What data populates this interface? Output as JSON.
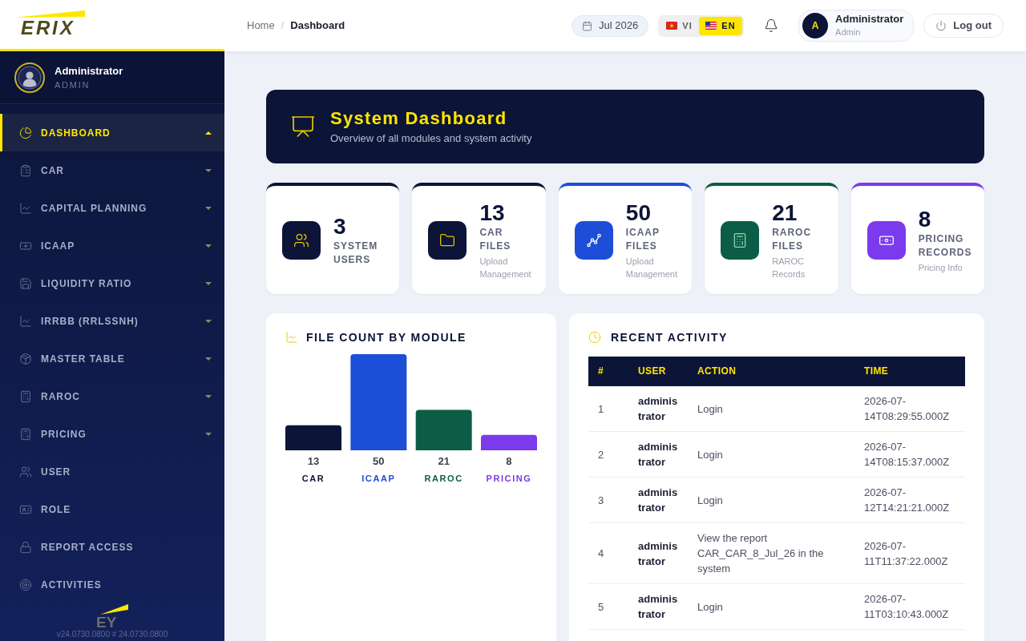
{
  "header": {
    "logo": "ERIX",
    "breadcrumb": [
      {
        "label": "Home",
        "current": false
      },
      {
        "label": "Dashboard",
        "current": true
      }
    ],
    "breadcrumb_separator": "/",
    "date": "Jul 2026",
    "languages": [
      {
        "code": "VI",
        "selected": false
      },
      {
        "code": "EN",
        "selected": true
      }
    ],
    "user": {
      "avatar_letter": "A",
      "name": "Administrator",
      "role": "Admin"
    },
    "logout": "Log out"
  },
  "sidebar": {
    "profile": {
      "name": "Administrator",
      "role": "ADMIN"
    },
    "items": [
      {
        "label": "DASHBOARD",
        "kind": "group",
        "selected": true,
        "expanded": true
      },
      {
        "label": "CAR",
        "kind": "group",
        "selected": false,
        "expanded": false
      },
      {
        "label": "CAPITAL PLANNING",
        "kind": "group",
        "selected": false,
        "expanded": false
      },
      {
        "label": "ICAAP",
        "kind": "group",
        "selected": false,
        "expanded": false
      },
      {
        "label": "LIQUIDITY RATIO",
        "kind": "group",
        "selected": false,
        "expanded": false
      },
      {
        "label": "IRRBB (RRLSSNH)",
        "kind": "group",
        "selected": false,
        "expanded": false
      },
      {
        "label": "MASTER TABLE",
        "kind": "group",
        "selected": false,
        "expanded": false
      },
      {
        "label": "RAROC",
        "kind": "group",
        "selected": false,
        "expanded": false
      },
      {
        "label": "PRICING",
        "kind": "group",
        "selected": false,
        "expanded": false
      },
      {
        "label": "USER",
        "kind": "link",
        "selected": false
      },
      {
        "label": "ROLE",
        "kind": "link",
        "selected": false
      },
      {
        "label": "REPORT ACCESS",
        "kind": "link",
        "selected": false
      },
      {
        "label": "ACTIVITIES",
        "kind": "link",
        "selected": false
      }
    ],
    "footer_logo": "EY",
    "version": "v24.0730.0800 # 24.0730.0800"
  },
  "banner": {
    "title": "System Dashboard",
    "subtitle": "Overview of all modules and system activity"
  },
  "stats": [
    {
      "value": "3",
      "label": "SYSTEM USERS",
      "color": "#0c1437"
    },
    {
      "value": "13",
      "label": "CAR FILES",
      "note": "Upload Management",
      "color": "#0c1437"
    },
    {
      "value": "50",
      "label": "ICAAP FILES",
      "note": "Upload Management",
      "color": "#1d4ed8"
    },
    {
      "value": "21",
      "label": "RAROC FILES",
      "note": "RAROC Records",
      "color": "#0b5e45"
    },
    {
      "value": "8",
      "label": "PRICING RECORDS",
      "note": "Pricing Info",
      "color": "#7c3aed"
    }
  ],
  "file_chart": {
    "title": "FILE COUNT BY MODULE",
    "chart_data": {
      "type": "bar",
      "categories": [
        "CAR",
        "ICAAP",
        "RAROC",
        "PRICING"
      ],
      "values": [
        13,
        50,
        21,
        8
      ],
      "colors": [
        "#0c1437",
        "#1d4ed8",
        "#0b5e45",
        "#7c3aed"
      ],
      "data_labels": true
    }
  },
  "recent_activity": {
    "title": "RECENT ACTIVITY",
    "columns": [
      "#",
      "USER",
      "ACTION",
      "TIME"
    ],
    "rows": [
      {
        "number": "1",
        "user": "administrator",
        "action": "Login",
        "time": "2026-07-14T08:29:55.000Z"
      },
      {
        "number": "2",
        "user": "administrator",
        "action": "Login",
        "time": "2026-07-14T08:15:37.000Z"
      },
      {
        "number": "3",
        "user": "administrator",
        "action": "Login",
        "time": "2026-07-12T14:21:21.000Z"
      },
      {
        "number": "4",
        "user": "administrator",
        "action": "View the report CAR_CAR_8_Jul_26 in the system",
        "time": "2026-07-11T11:37:22.000Z"
      },
      {
        "number": "5",
        "user": "administrator",
        "action": "Login",
        "time": "2026-07-11T03:10:43.000Z"
      }
    ]
  }
}
